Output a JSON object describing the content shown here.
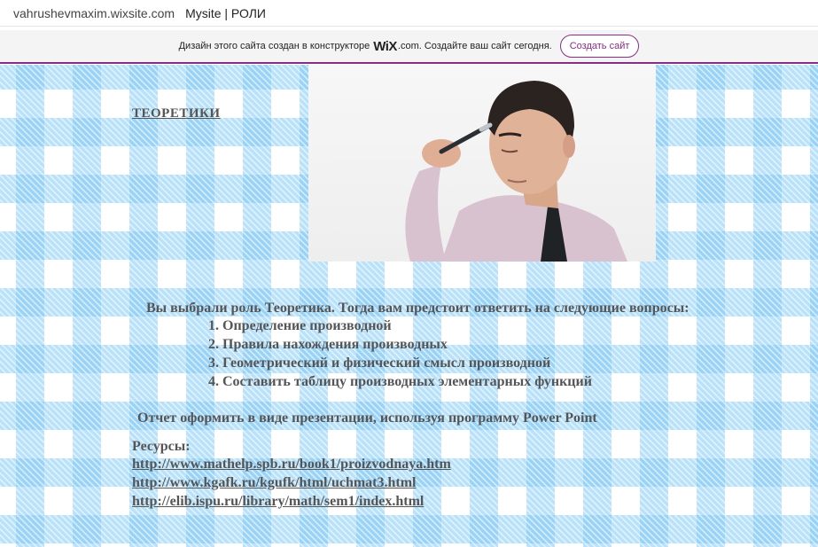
{
  "browser": {
    "domain": "vahrushevmaxim.wixsite.com",
    "title": "Mysite | РОЛИ"
  },
  "wix_banner": {
    "text_before": "Дизайн этого сайта создан в конструкторе",
    "logo": "WiX",
    "text_after": ".com. Создайте ваш сайт сегодня.",
    "button_label": "Создать сайт"
  },
  "page": {
    "heading": "ТЕОРЕТИКИ",
    "intro": "Вы выбрали роль Теоретика. Тогда вам предстоит ответить на следующие вопросы:",
    "questions": [
      "1. Определение производной",
      "2. Правила нахождения производных",
      "3. Геометрический и физический смысл производной",
      "4. Составить таблицу производных элементарных  функций"
    ],
    "report": "Отчет оформить в виде презентации, используя программу Power Point",
    "resources_label": "Ресурсы:",
    "links": [
      "http://www.mathelp.spb.ru/book1/proizvodnaya.htm",
      "http://www.kgafk.ru/kgufk/html/uchmat3.html",
      "http://elib.ispu.ru/library/math/sem1/index.html"
    ]
  },
  "colors": {
    "wix_accent": "#8a2d88",
    "check_blue": "#7dc8f5",
    "text_gray": "#555555"
  }
}
